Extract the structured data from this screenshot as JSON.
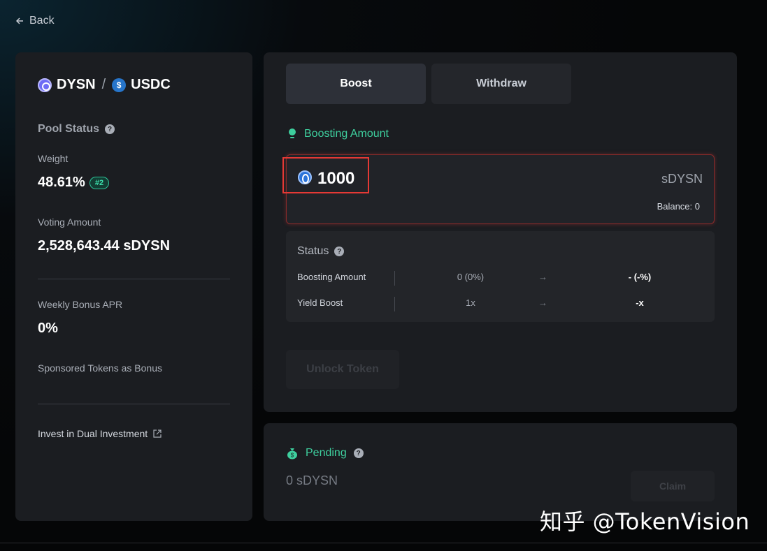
{
  "nav": {
    "back_label": "Back"
  },
  "pool": {
    "token_a": "DYSN",
    "separator": "/",
    "token_b": "USDC",
    "status_title": "Pool Status",
    "weight_label": "Weight",
    "weight_value": "48.61%",
    "weight_rank": "#2",
    "voting_label": "Voting Amount",
    "voting_value": "2,528,643.44 sDYSN",
    "apr_label": "Weekly Bonus APR",
    "apr_value": "0%",
    "sponsored_label": "Sponsored Tokens as Bonus",
    "invest_link": "Invest in Dual Investment"
  },
  "tabs": [
    {
      "label": "Boost",
      "active": true
    },
    {
      "label": "Withdraw",
      "active": false
    }
  ],
  "boost": {
    "section_title": "Boosting Amount",
    "amount_value": "1000",
    "unit": "sDYSN",
    "balance_text": "Balance: 0",
    "status_title": "Status",
    "rows": [
      {
        "label": "Boosting Amount",
        "current": "0 (0%)",
        "arrow": "→",
        "next": "- (-%)"
      },
      {
        "label": "Yield Boost",
        "current": "1x",
        "arrow": "→",
        "next": "-x"
      }
    ],
    "unlock_button": "Unlock Token"
  },
  "pending": {
    "title": "Pending",
    "value": "0 sDYSN",
    "claim_button": "Claim"
  },
  "watermark": "知乎 @TokenVision",
  "colors": {
    "accent_green": "#3ecf9e",
    "card_bg": "#1b1d21",
    "highlight_red": "#e53935"
  }
}
